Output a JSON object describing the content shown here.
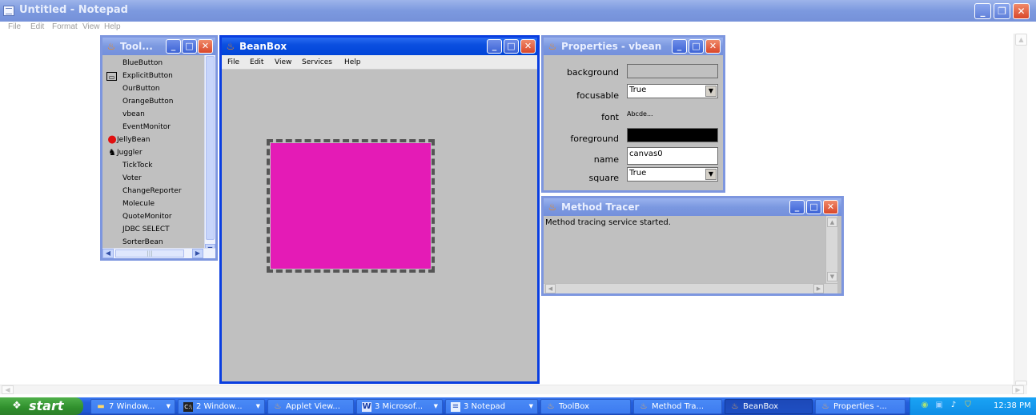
{
  "notepad": {
    "title": "Untitled - Notepad",
    "menu": [
      "File",
      "Edit",
      "Format",
      "View",
      "Help"
    ]
  },
  "toolbox": {
    "title": "Tool...",
    "items": [
      {
        "label": "BlueButton",
        "icon": ""
      },
      {
        "label": "ExplicitButton",
        "icon": "button-icon"
      },
      {
        "label": "OurButton",
        "icon": ""
      },
      {
        "label": "OrangeButton",
        "icon": ""
      },
      {
        "label": "vbean",
        "icon": ""
      },
      {
        "label": "EventMonitor",
        "icon": ""
      },
      {
        "label": "JellyBean",
        "icon": "jellybean-icon"
      },
      {
        "label": "Juggler",
        "icon": "juggler-icon"
      },
      {
        "label": "TickTock",
        "icon": ""
      },
      {
        "label": "Voter",
        "icon": ""
      },
      {
        "label": "ChangeReporter",
        "icon": ""
      },
      {
        "label": "Molecule",
        "icon": ""
      },
      {
        "label": "QuoteMonitor",
        "icon": ""
      },
      {
        "label": "JDBC SELECT",
        "icon": ""
      },
      {
        "label": "SorterBean",
        "icon": ""
      }
    ]
  },
  "beanbox": {
    "title": "BeanBox",
    "menu": [
      "File",
      "Edit",
      "View",
      "Services",
      "Help"
    ],
    "bean_color": "#e41bb6"
  },
  "properties": {
    "title": "Properties - vbean",
    "labels": {
      "background": "background",
      "focusable": "focusable",
      "font": "font",
      "foreground": "foreground",
      "name": "name",
      "square": "square"
    },
    "values": {
      "background_color": "#c0c0c0",
      "focusable": "True",
      "font": "Abcde...",
      "foreground_color": "#000000",
      "name": "canvas0",
      "square": "True"
    }
  },
  "tracer": {
    "title": "Method Tracer",
    "text": "Method tracing service started."
  },
  "taskbar": {
    "start_label": "start",
    "buttons": [
      {
        "label": "7 Window...",
        "icon": "folder-icon",
        "group": true
      },
      {
        "label": "2 Window...",
        "icon": "console-icon",
        "group": true
      },
      {
        "label": "Applet View...",
        "icon": "java-icon",
        "group": false
      },
      {
        "label": "3 Microsof...",
        "icon": "word-icon",
        "group": true
      },
      {
        "label": "3 Notepad",
        "icon": "notepad-icon",
        "group": true
      },
      {
        "label": "ToolBox",
        "icon": "java-icon",
        "group": false
      },
      {
        "label": "Method Tra...",
        "icon": "java-icon",
        "group": false
      },
      {
        "label": "BeanBox",
        "icon": "java-icon",
        "group": false,
        "active": true
      },
      {
        "label": "Properties -...",
        "icon": "java-icon",
        "group": false
      }
    ],
    "clock": "12:38 PM"
  }
}
